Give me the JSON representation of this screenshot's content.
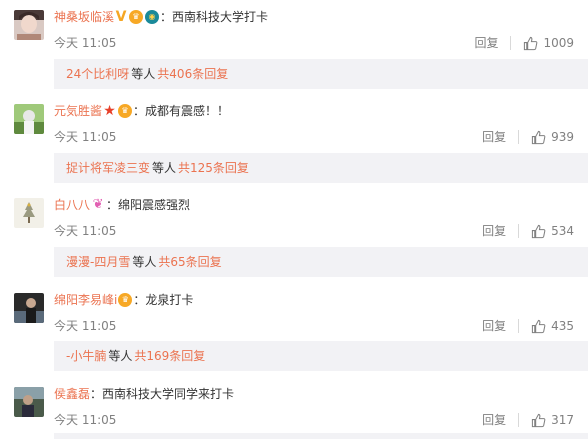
{
  "comments": [
    {
      "username": "神桑坂临溪",
      "badges": [
        "vip-v",
        "vip-crown",
        "fans"
      ],
      "sep": "：",
      "content": "西南科技大学打卡",
      "time": "今天 11:05",
      "reply_label": "回复",
      "likes": "1009",
      "reply_preview": {
        "user": "24个比利呀",
        "mid": "等人",
        "total": "共406条回复"
      }
    },
    {
      "username": "元気胜酱",
      "badges": [
        "star",
        "vip-crown"
      ],
      "sep": "：",
      "content": "成都有震感！！",
      "time": "今天 11:05",
      "reply_label": "回复",
      "likes": "939",
      "reply_preview": {
        "user": "捉计将军凌三变",
        "mid": "等人",
        "total": "共125条回复"
      }
    },
    {
      "username": "白八八",
      "badges": [
        "bow"
      ],
      "sep": "：",
      "content": "绵阳震感强烈",
      "time": "今天 11:05",
      "reply_label": "回复",
      "likes": "534",
      "reply_preview": {
        "user": "漫漫-四月雪",
        "mid": "等人",
        "total": "共65条回复"
      }
    },
    {
      "username": "绵阳李易峰i",
      "badges": [
        "vip-crown"
      ],
      "sep": "：",
      "content": "龙泉打卡",
      "time": "今天 11:05",
      "reply_label": "回复",
      "likes": "435",
      "reply_preview": {
        "user": "-小牛腩",
        "mid": "等人",
        "total": "共169条回复"
      }
    },
    {
      "username": "侯鑫磊",
      "badges": [],
      "sep": "：",
      "content": "西南科技大学同学来打卡",
      "time": "今天 11:05",
      "reply_label": "回复",
      "likes": "317",
      "reply_preview": null
    }
  ],
  "colors": {
    "username": "#eb7350",
    "text": "#333333",
    "meta": "#808080",
    "reply_bg": "#f2f2f5"
  }
}
